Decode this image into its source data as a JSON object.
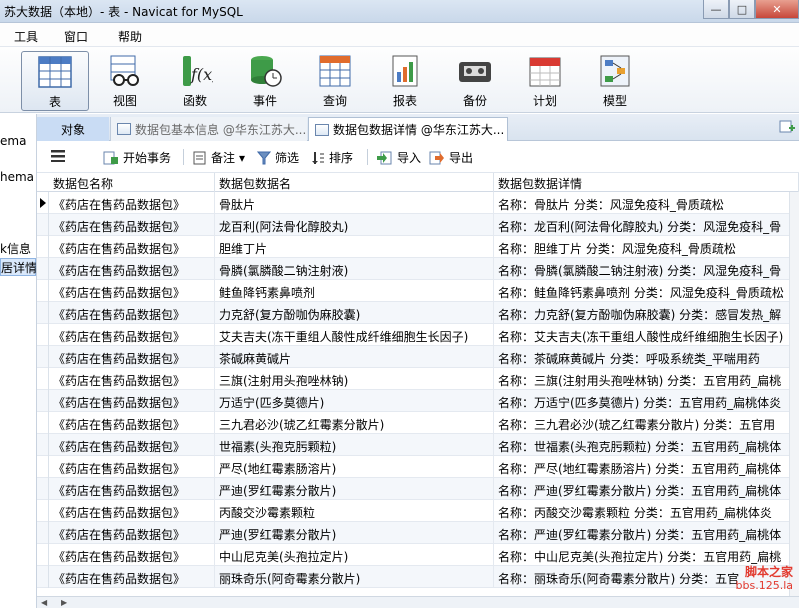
{
  "window": {
    "title": "苏大数据（本地）- 表 - Navicat for MySQL",
    "buttons": {
      "minimize": "—",
      "maximize": "□",
      "close": "✕"
    }
  },
  "menu": {
    "items": [
      "工具",
      "窗口",
      "帮助"
    ]
  },
  "toolbar": {
    "tools": [
      {
        "label": "表",
        "icon": "table-icon",
        "active": true
      },
      {
        "label": "视图",
        "icon": "view-icon"
      },
      {
        "label": "函数",
        "icon": "function-icon"
      },
      {
        "label": "事件",
        "icon": "event-icon"
      },
      {
        "label": "查询",
        "icon": "query-icon"
      },
      {
        "label": "报表",
        "icon": "report-icon"
      },
      {
        "label": "备份",
        "icon": "backup-icon"
      },
      {
        "label": "计划",
        "icon": "schedule-icon"
      },
      {
        "label": "模型",
        "icon": "model-icon"
      }
    ]
  },
  "left_pane": {
    "items": [
      "ema",
      "hema",
      "k信息",
      "居详情"
    ]
  },
  "tabs": {
    "object": "对象",
    "tab1": "数据包基本信息 @华东江苏大...",
    "tab2": "数据包数据详情 @华东江苏大..."
  },
  "actions": {
    "begin_transaction": "开始事务",
    "memo": "备注",
    "memo_arrow": "▾",
    "filter": "筛选",
    "sort": "排序",
    "import": "导入",
    "export": "导出"
  },
  "grid": {
    "columns": [
      "数据包名称",
      "数据包数据名",
      "数据包数据详情"
    ],
    "rows": [
      [
        "《药店在售药品数据包》",
        "骨肽片",
        "名称：骨肽片    分类：风湿免疫科_骨质疏松"
      ],
      [
        "《药店在售药品数据包》",
        "龙百利(阿法骨化醇胶丸)",
        "名称：龙百利(阿法骨化醇胶丸)    分类：风湿免疫科_骨"
      ],
      [
        "《药店在售药品数据包》",
        "胆维丁片",
        "名称：胆维丁片    分类：风湿免疫科_骨质疏松"
      ],
      [
        "《药店在售药品数据包》",
        "骨膦(氯膦酸二钠注射液)",
        "名称：骨膦(氯膦酸二钠注射液)    分类：风湿免疫科_骨"
      ],
      [
        "《药店在售药品数据包》",
        "鲑鱼降钙素鼻喷剂",
        "名称：鲑鱼降钙素鼻喷剂    分类：风湿免疫科_骨质疏松"
      ],
      [
        "《药店在售药品数据包》",
        "力克舒(复方酚咖伪麻胶囊)",
        "名称：力克舒(复方酚咖伪麻胶囊)    分类：感冒发热_解"
      ],
      [
        "《药店在售药品数据包》",
        "艾夫吉夫(冻干重组人酸性成纤维细胞生长因子)",
        "名称：艾夫吉夫(冻干重组人酸性成纤维细胞生长因子)"
      ],
      [
        "《药店在售药品数据包》",
        "茶碱麻黄碱片",
        "名称：茶碱麻黄碱片    分类：呼吸系统类_平喘用药"
      ],
      [
        "《药店在售药品数据包》",
        "三旗(注射用头孢唑林钠)",
        "名称：三旗(注射用头孢唑林钠)    分类：五官用药_扁桃"
      ],
      [
        "《药店在售药品数据包》",
        "万适宁(匹多莫德片)",
        "名称：万适宁(匹多莫德片)    分类：五官用药_扁桃体炎"
      ],
      [
        "《药店在售药品数据包》",
        "三九君必沙(琥乙红霉素分散片)",
        "名称：三九君必沙(琥乙红霉素分散片)    分类：五官用"
      ],
      [
        "《药店在售药品数据包》",
        "世福素(头孢克肟颗粒)",
        "名称：世福素(头孢克肟颗粒)    分类：五官用药_扁桃体"
      ],
      [
        "《药店在售药品数据包》",
        "严尽(地红霉素肠溶片)",
        "名称：严尽(地红霉素肠溶片)    分类：五官用药_扁桃体"
      ],
      [
        "《药店在售药品数据包》",
        "严迪(罗红霉素分散片)",
        "名称：严迪(罗红霉素分散片)    分类：五官用药_扁桃体"
      ],
      [
        "《药店在售药品数据包》",
        "丙酸交沙霉素颗粒",
        "名称：丙酸交沙霉素颗粒    分类：五官用药_扁桃体炎"
      ],
      [
        "《药店在售药品数据包》",
        "严迪(罗红霉素分散片)",
        "名称：严迪(罗红霉素分散片)    分类：五官用药_扁桃体"
      ],
      [
        "《药店在售药品数据包》",
        "中山尼克美(头孢拉定片)",
        "名称：中山尼克美(头孢拉定片)    分类：五官用药_扁桃"
      ],
      [
        "《药店在售药品数据包》",
        "丽珠奇乐(阿奇霉素分散片)",
        "名称：丽珠奇乐(阿奇霉素分散片)    分类：五官"
      ]
    ]
  },
  "statusbar": {
    "left_arrow": "◀",
    "right_arrow": "▶"
  },
  "watermark": {
    "line1": "脚本之家",
    "line2": "bbs.125.la"
  }
}
